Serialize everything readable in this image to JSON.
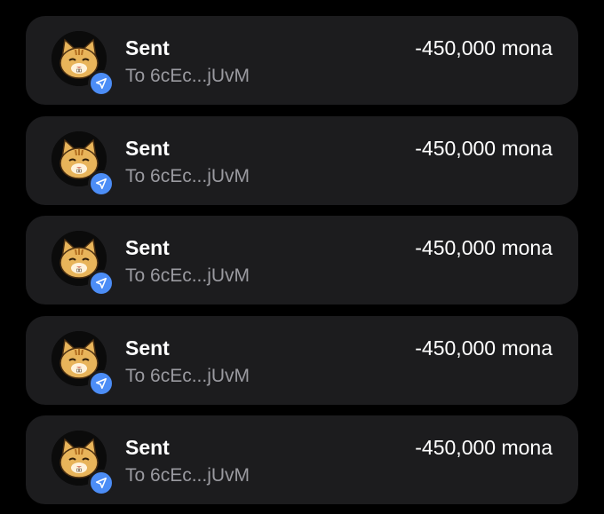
{
  "transactions": [
    {
      "title": "Sent",
      "counterparty": "To 6cEc...jUvM",
      "amount": "-450,000 mona",
      "avatar_icon": "cat-icon",
      "badge_icon": "send-arrow-icon"
    },
    {
      "title": "Sent",
      "counterparty": "To 6cEc...jUvM",
      "amount": "-450,000 mona",
      "avatar_icon": "cat-icon",
      "badge_icon": "send-arrow-icon"
    },
    {
      "title": "Sent",
      "counterparty": "To 6cEc...jUvM",
      "amount": "-450,000 mona",
      "avatar_icon": "cat-icon",
      "badge_icon": "send-arrow-icon"
    },
    {
      "title": "Sent",
      "counterparty": "To 6cEc...jUvM",
      "amount": "-450,000 mona",
      "avatar_icon": "cat-icon",
      "badge_icon": "send-arrow-icon"
    },
    {
      "title": "Sent",
      "counterparty": "To 6cEc...jUvM",
      "amount": "-450,000 mona",
      "avatar_icon": "cat-icon",
      "badge_icon": "send-arrow-icon"
    }
  ],
  "colors": {
    "background": "#000000",
    "card": "#1c1c1e",
    "primary_text": "#ffffff",
    "secondary_text": "#9a9aa0",
    "badge_accent": "#4c8df6",
    "avatar_fur": "#e8b45a"
  }
}
